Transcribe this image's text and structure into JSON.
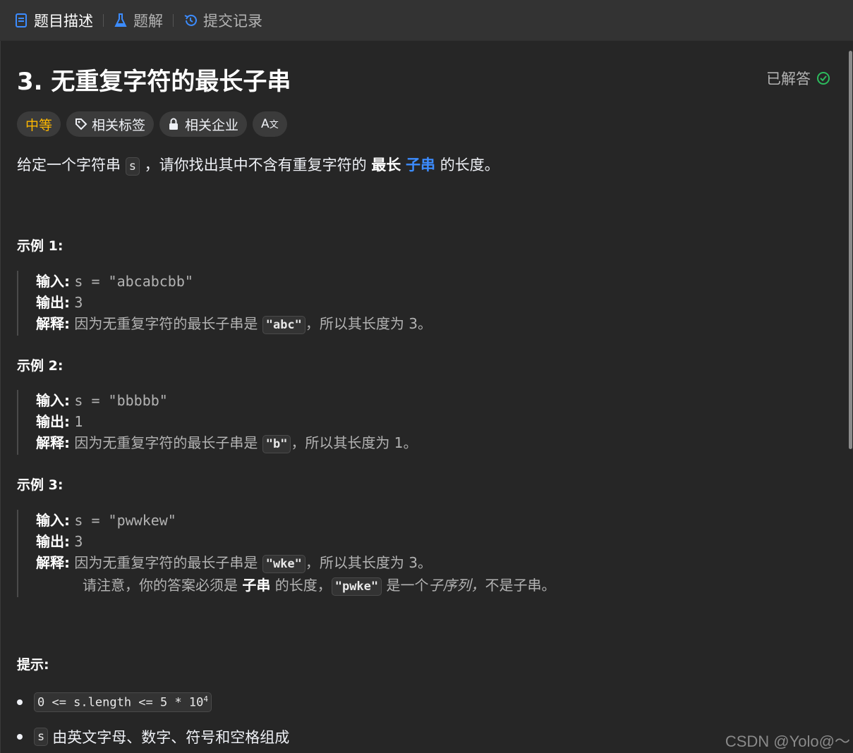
{
  "tabs": [
    {
      "label": "题目描述",
      "icon": "description-icon",
      "active": true
    },
    {
      "label": "题解",
      "icon": "flask-icon",
      "active": false
    },
    {
      "label": "提交记录",
      "icon": "history-icon",
      "active": false
    }
  ],
  "problem": {
    "title": "3. 无重复字符的最长子串",
    "status": "已解答",
    "difficulty": "中等",
    "tags_label": "相关标签",
    "companies_label": "相关企业",
    "translate_label": "A",
    "desc_prefix": "给定一个字符串",
    "desc_code": "s",
    "desc_mid": "，请你找出其中不含有重复字符的",
    "desc_bold": "最长",
    "desc_link": "子串",
    "desc_suffix": "的长度。"
  },
  "labels": {
    "input": "输入:",
    "output": "输出:",
    "explain": "解释:"
  },
  "examples": [
    {
      "title": "示例 1:",
      "input": "s = \"abcabcbb\"",
      "output": "3",
      "explain_prefix": "因为无重复字符的最长子串是",
      "explain_code": "\"abc\"",
      "explain_suffix": "，所以其长度为 3。"
    },
    {
      "title": "示例 2:",
      "input": "s = \"bbbbb\"",
      "output": "1",
      "explain_prefix": "因为无重复字符的最长子串是",
      "explain_code": "\"b\"",
      "explain_suffix": "，所以其长度为 1。"
    },
    {
      "title": "示例 3:",
      "input": "s = \"pwwkew\"",
      "output": "3",
      "explain_prefix": "因为无重复字符的最长子串是",
      "explain_code": "\"wke\"",
      "explain_suffix": "，所以其长度为 3。",
      "note_prefix": "请注意，你的答案必须是",
      "note_bold": "子串",
      "note_mid": "的长度，",
      "note_code": "\"pwke\"",
      "note_mid2": "是一个",
      "note_italic": "子序列，",
      "note_suffix": "不是子串。"
    }
  ],
  "hints": {
    "title": "提示:",
    "items": [
      {
        "code": "0 <= s.length <= 5 * 10",
        "sup": "4",
        "text": ""
      },
      {
        "code": "s",
        "sup": "",
        "text": "由英文字母、数字、符号和空格组成"
      }
    ]
  },
  "watermark": "CSDN @Yolo@～"
}
